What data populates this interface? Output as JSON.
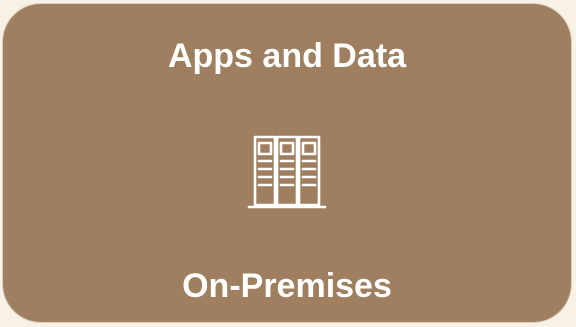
{
  "card": {
    "title": "Apps and Data",
    "subtitle": "On-Premises",
    "icon": "server-rack-icon"
  },
  "colors": {
    "card_background": "#9f7f5f",
    "text": "#ffffff",
    "page_background": "#f7f1e6"
  }
}
